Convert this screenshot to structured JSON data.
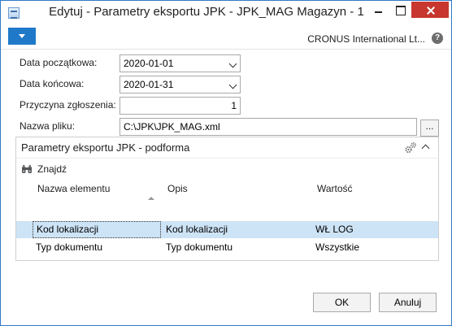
{
  "window": {
    "title": "Edytuj - Parametry eksportu JPK - JPK_MAG Magazyn - 1"
  },
  "ribbon": {
    "company": "CRONUS International Lt...",
    "help_glyph": "?"
  },
  "fields": {
    "start_date": {
      "label": "Data początkowa:",
      "value": "2020-01-01"
    },
    "end_date": {
      "label": "Data końcowa:",
      "value": "2020-01-31"
    },
    "reason": {
      "label": "Przyczyna zgłoszenia:",
      "value": "1"
    },
    "file_name": {
      "label": "Nazwa pliku:",
      "value": "C:\\JPK\\JPK_MAG.xml",
      "browse_label": "..."
    }
  },
  "subform": {
    "title": "Parametry eksportu JPK - podforma",
    "find_label": "Znajdź",
    "columns": [
      "Nazwa elementu",
      "Opis",
      "Wartość"
    ],
    "rows": [
      [
        "Kod lokalizacji",
        "Kod lokalizacji",
        "WŁ LOG"
      ],
      [
        "Typ dokumentu",
        "Typ dokumentu",
        "Wszystkie"
      ]
    ]
  },
  "buttons": {
    "ok": "OK",
    "cancel": "Anuluj"
  },
  "icons": [
    "app-icon",
    "minimize-icon",
    "maximize-icon",
    "close-icon",
    "menu-dropdown-icon",
    "help-icon",
    "chevron-down-icon",
    "gears-icon",
    "chevron-up-icon",
    "binoculars-icon",
    "sort-ascending-icon"
  ],
  "colors": {
    "accent": "#1f79c8",
    "close": "#c7372f",
    "selected_row": "#cde3f6",
    "border": "#2f7ac9"
  }
}
